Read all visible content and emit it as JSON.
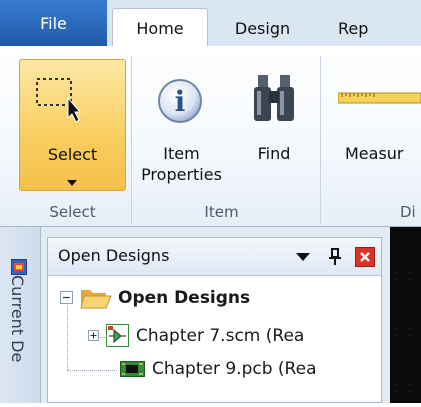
{
  "tabs": {
    "file": "File",
    "home": "Home",
    "design": "Design",
    "rep": "Rep"
  },
  "ribbon": {
    "select": {
      "label": "Select",
      "group": "Select"
    },
    "item_properties": {
      "line1": "Item",
      "line2": "Properties"
    },
    "find": {
      "label": "Find"
    },
    "item_group": "Item",
    "measure": {
      "label": "Measur"
    },
    "di_group": "Di"
  },
  "sidetab": {
    "label": "Current De"
  },
  "panel": {
    "title": "Open Designs",
    "tree": {
      "root": "Open Designs",
      "items": [
        {
          "label": "Chapter 7.scm (Rea",
          "icon": "schematic-icon"
        },
        {
          "label": "Chapter 9.pcb (Rea",
          "icon": "pcb-icon"
        }
      ]
    }
  },
  "colors": {
    "file_tab": "#2a66bb",
    "select_highlight": "#f9cf63",
    "close_button": "#d9332a"
  }
}
